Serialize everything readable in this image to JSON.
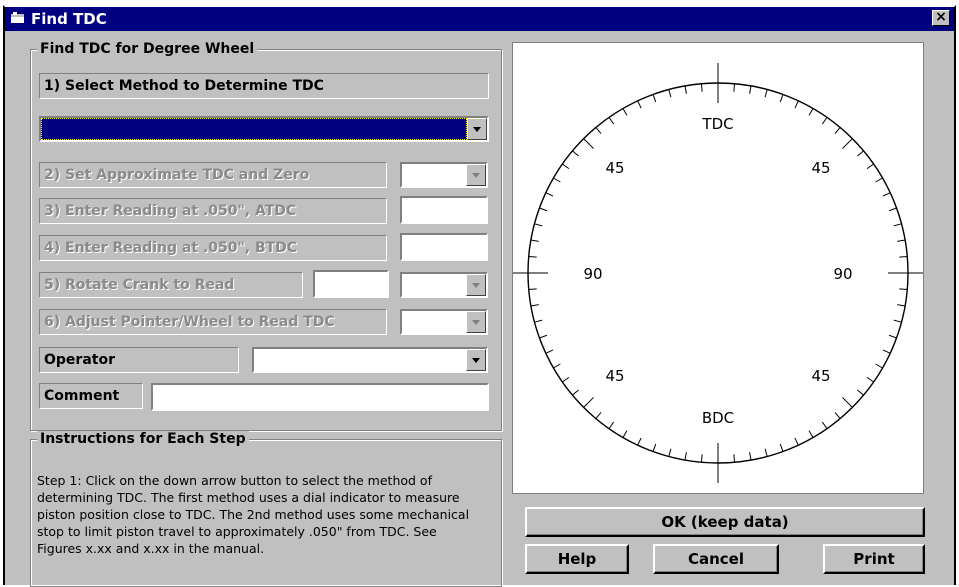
{
  "window": {
    "title": "Find TDC",
    "close_glyph": "×"
  },
  "find_group": {
    "legend": "Find TDC for Degree Wheel",
    "step1_label": "1) Select Method to Determine TDC",
    "step2_label": "2) Set Approximate TDC and Zero",
    "step3_label": "3) Enter Reading at .050\", ATDC",
    "step4_label": "4) Enter Reading at .050\", BTDC",
    "step5_label": "5) Rotate Crank to Read",
    "step6_label": "6) Adjust Pointer/Wheel to Read TDC",
    "operator_label": "Operator",
    "comment_label": "Comment"
  },
  "instructions": {
    "legend": "Instructions for Each Step",
    "text": "Step 1:  Click on the down arrow button to select the method of determining TDC.  The first method uses a dial indicator to measure piston position close to TDC.  The 2nd method uses some mechanical stop to limit piston travel to approximately .050\" from TDC.  See Figures x.xx and x.xx in the manual."
  },
  "wheel": {
    "top": "TDC",
    "bottom": "BDC",
    "upper_left": "45",
    "upper_right": "45",
    "left": "90",
    "right": "90",
    "lower_left": "45",
    "lower_right": "45"
  },
  "buttons": {
    "ok": "OK (keep data)",
    "help": "Help",
    "cancel": "Cancel",
    "print": "Print"
  },
  "colors": {
    "title_bar": "#000080",
    "face": "#c0c0c0",
    "selected_combo": "#000080"
  }
}
